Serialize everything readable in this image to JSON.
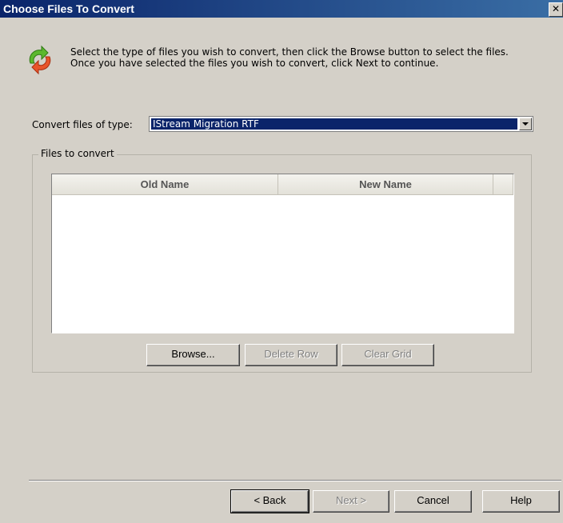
{
  "window": {
    "title": "Choose Files To Convert",
    "close_glyph": "✕"
  },
  "header": {
    "icon": "convert-arrows-icon",
    "line1": "Select the type of files you wish to convert, then click the Browse button to select the files.",
    "line2": "Once you have selected the files you wish to convert, click Next to continue."
  },
  "convert_type": {
    "label": "Convert files of type:",
    "value": "IStream Migration RTF"
  },
  "files_group": {
    "label": "Files to convert",
    "columns": [
      "Old Name",
      "New Name"
    ],
    "rows": []
  },
  "grid_buttons": {
    "browse": "Browse...",
    "delete_row": "Delete Row",
    "clear_grid": "Clear Grid"
  },
  "nav_buttons": {
    "back": "< Back",
    "next": "Next >",
    "cancel": "Cancel",
    "help": "Help"
  },
  "colors": {
    "title_bar": "#0a246a",
    "dialog_bg": "#d4d0c8",
    "selection": "#0a246a"
  }
}
